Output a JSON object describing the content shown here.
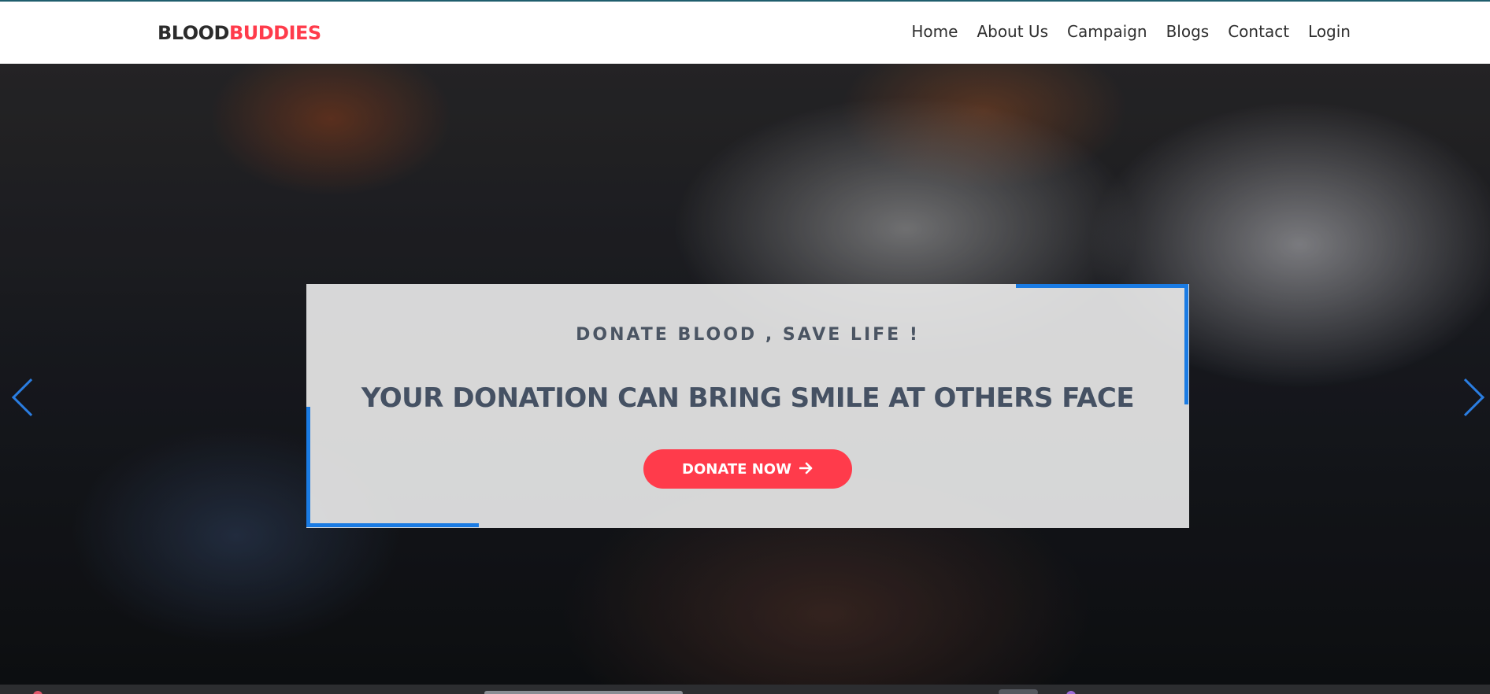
{
  "brand": {
    "part1": "BLOOD",
    "part2": "BUDDIES"
  },
  "nav": {
    "items": [
      {
        "label": "Home"
      },
      {
        "label": "About Us"
      },
      {
        "label": "Campaign"
      },
      {
        "label": "Blogs"
      },
      {
        "label": "Contact"
      },
      {
        "label": "Login"
      }
    ]
  },
  "hero": {
    "kicker": "DONATE BLOOD , SAVE LIFE !",
    "headline": "YOUR DONATION CAN BRING SMILE AT OTHERS FACE",
    "cta_label": "DONATE NOW",
    "cta_icon": "arrow-right-icon",
    "prev_icon": "chevron-left-icon",
    "next_icon": "chevron-right-icon"
  },
  "colors": {
    "accent_red": "#ff3b4b",
    "accent_blue": "#1a7be3",
    "text_dark": "#455163"
  }
}
